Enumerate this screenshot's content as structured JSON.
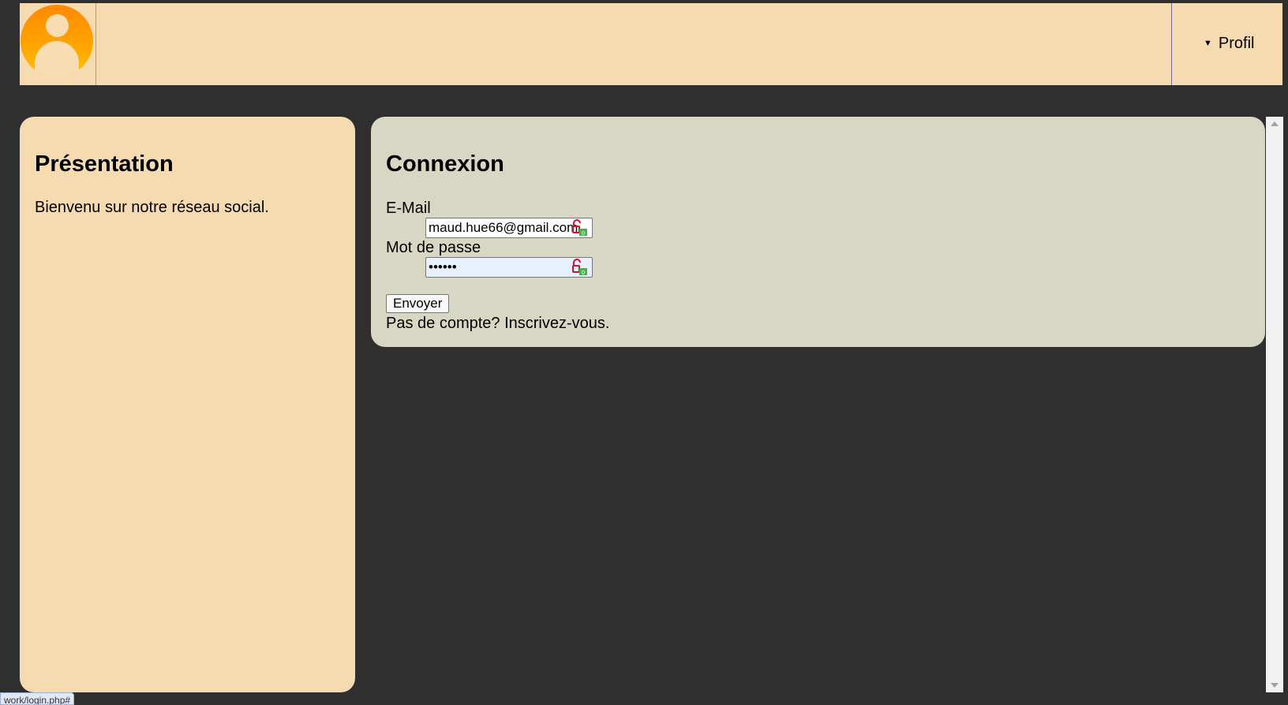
{
  "header": {
    "avatar_icon": "user-avatar-icon",
    "profile_label": "Profil",
    "caret_icon": "triangle-down-icon"
  },
  "presentation": {
    "title": "Présentation",
    "text": "Bienvenu sur notre réseau social."
  },
  "login": {
    "title": "Connexion",
    "email_label": "E-Mail",
    "email_value": "maud.hue66@gmail.com",
    "password_label": "Mot de passe",
    "password_value": "••••••",
    "submit_label": "Envoyer",
    "signup_text": "Pas de compte? Inscrivez-vous.",
    "field_icon": "password-manager-lock-icon"
  },
  "status_bar": {
    "url_fragment": "work/login.php#"
  },
  "colors": {
    "background": "#2f2f2f",
    "panel_beige": "#f6dbb0",
    "panel_gray": "#d8d7c3",
    "avatar_orange": "#ff8a00"
  }
}
